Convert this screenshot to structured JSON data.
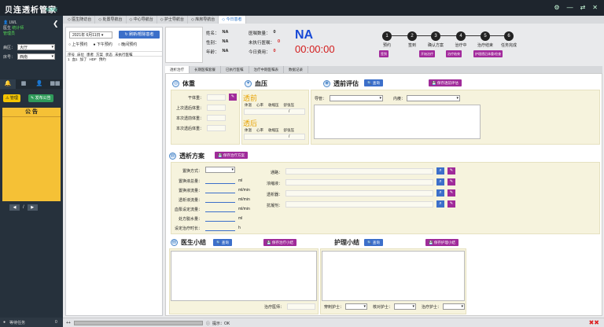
{
  "app": {
    "title": "贝连透析管家",
    "version": "标准版"
  },
  "window_controls": [
    "⚙",
    "—",
    "⇄",
    "✕"
  ],
  "sidebar": {
    "user": "LWL",
    "role": "医生",
    "role_extra": "统计师",
    "role_line2": "管理员",
    "ward_label": "病区：",
    "ward_value": "大厅",
    "bed_label": "床号：",
    "bed_value": "西南",
    "nav_icons": [
      "🔔",
      "▦",
      "👤",
      "▦▦"
    ],
    "btn_manage": "管理",
    "btn_publish": "发布公告",
    "notice_title": "公 告",
    "pager_text": "/"
  },
  "tabs": [
    "医生随访台",
    "处置导航台",
    "中心导航台",
    "护士导航台",
    "库房导航台",
    "今日患者"
  ],
  "patient_list": {
    "date": "2021年 6月11日",
    "refresh": "刷新/根除患者",
    "radios": [
      "上午预约",
      "下午预约",
      "晚间预约"
    ],
    "headers": [
      "序号",
      "床位",
      "患者",
      "方案",
      "状态",
      "未执行医嘱"
    ],
    "row1": [
      "1",
      "血1",
      "加了",
      "HDF",
      "预约"
    ]
  },
  "patient_info": {
    "name_label": "姓名：",
    "name": "NA",
    "gender_label": "性别：",
    "gender": "NA",
    "age_label": "年龄：",
    "age": "NA",
    "orders_label": "医嘱数量：",
    "orders": "0",
    "unexec_label": "未执行医嘱：",
    "unexec": "0",
    "cost_label": "今日费用：",
    "cost": "0",
    "big_name": "NA",
    "timer": "00:00:00"
  },
  "workflow": {
    "steps": [
      {
        "num": "1",
        "label": "预约"
      },
      {
        "num": "2",
        "label": "签到"
      },
      {
        "num": "3",
        "label": "确认方案"
      },
      {
        "num": "4",
        "label": "治疗中"
      },
      {
        "num": "5",
        "label": "治疗结束"
      },
      {
        "num": "6",
        "label": "任务完成"
      }
    ],
    "buttons": [
      "签到",
      "开始治疗",
      "治疗结束",
      "护理透后体重/检查"
    ]
  },
  "subtabs": [
    "透析治疗",
    "长期医嘱套餐",
    "已执行医嘱",
    "治疗中期医嘱表",
    "数据记录"
  ],
  "weight": {
    "title": "体重",
    "dry": "干体重：",
    "last_after": "上次透后体重：",
    "pre": "本次透前体重：",
    "post": "本次透后体重："
  },
  "bp": {
    "title": "血压",
    "pre": "透前",
    "post": "透后",
    "cols": [
      "体温",
      "心率",
      "收缩压",
      "舒张压"
    ],
    "sep": "/"
  },
  "assessment": {
    "title": "透前评估",
    "btn_query": "查询",
    "btn_save": "保存透前评估",
    "access_label": "导管：",
    "inner_label": "内瘘："
  },
  "plan": {
    "title": "透析方案",
    "btn_save": "保存治疗方案",
    "left_fields": [
      "置换方式：",
      "置换液总量：",
      "置换液流量：",
      "透析液流量：",
      "血泵设定流量：",
      "处方脱水量：",
      "设定治疗时长："
    ],
    "units": [
      "ml",
      "ml/min",
      "ml/min",
      "ml/min",
      "ml",
      "h"
    ],
    "right_fields": [
      "通路：",
      "浓缩液：",
      "透析器：",
      "抗凝剂："
    ]
  },
  "doctor": {
    "title": "医生小结",
    "btn_query": "查询",
    "btn_save": "保存治疗小结",
    "sign": "治疗医师："
  },
  "nurse": {
    "title": "护理小结",
    "btn_query": "查询",
    "btn_save": "保存护理小结",
    "nurse1": "穿刺护士：",
    "nurse2": "核对护士：",
    "nurse3": "治疗护士："
  },
  "status": {
    "waiting": "等待任务",
    "waiting_count": "0",
    "hint": "提示：OK"
  }
}
